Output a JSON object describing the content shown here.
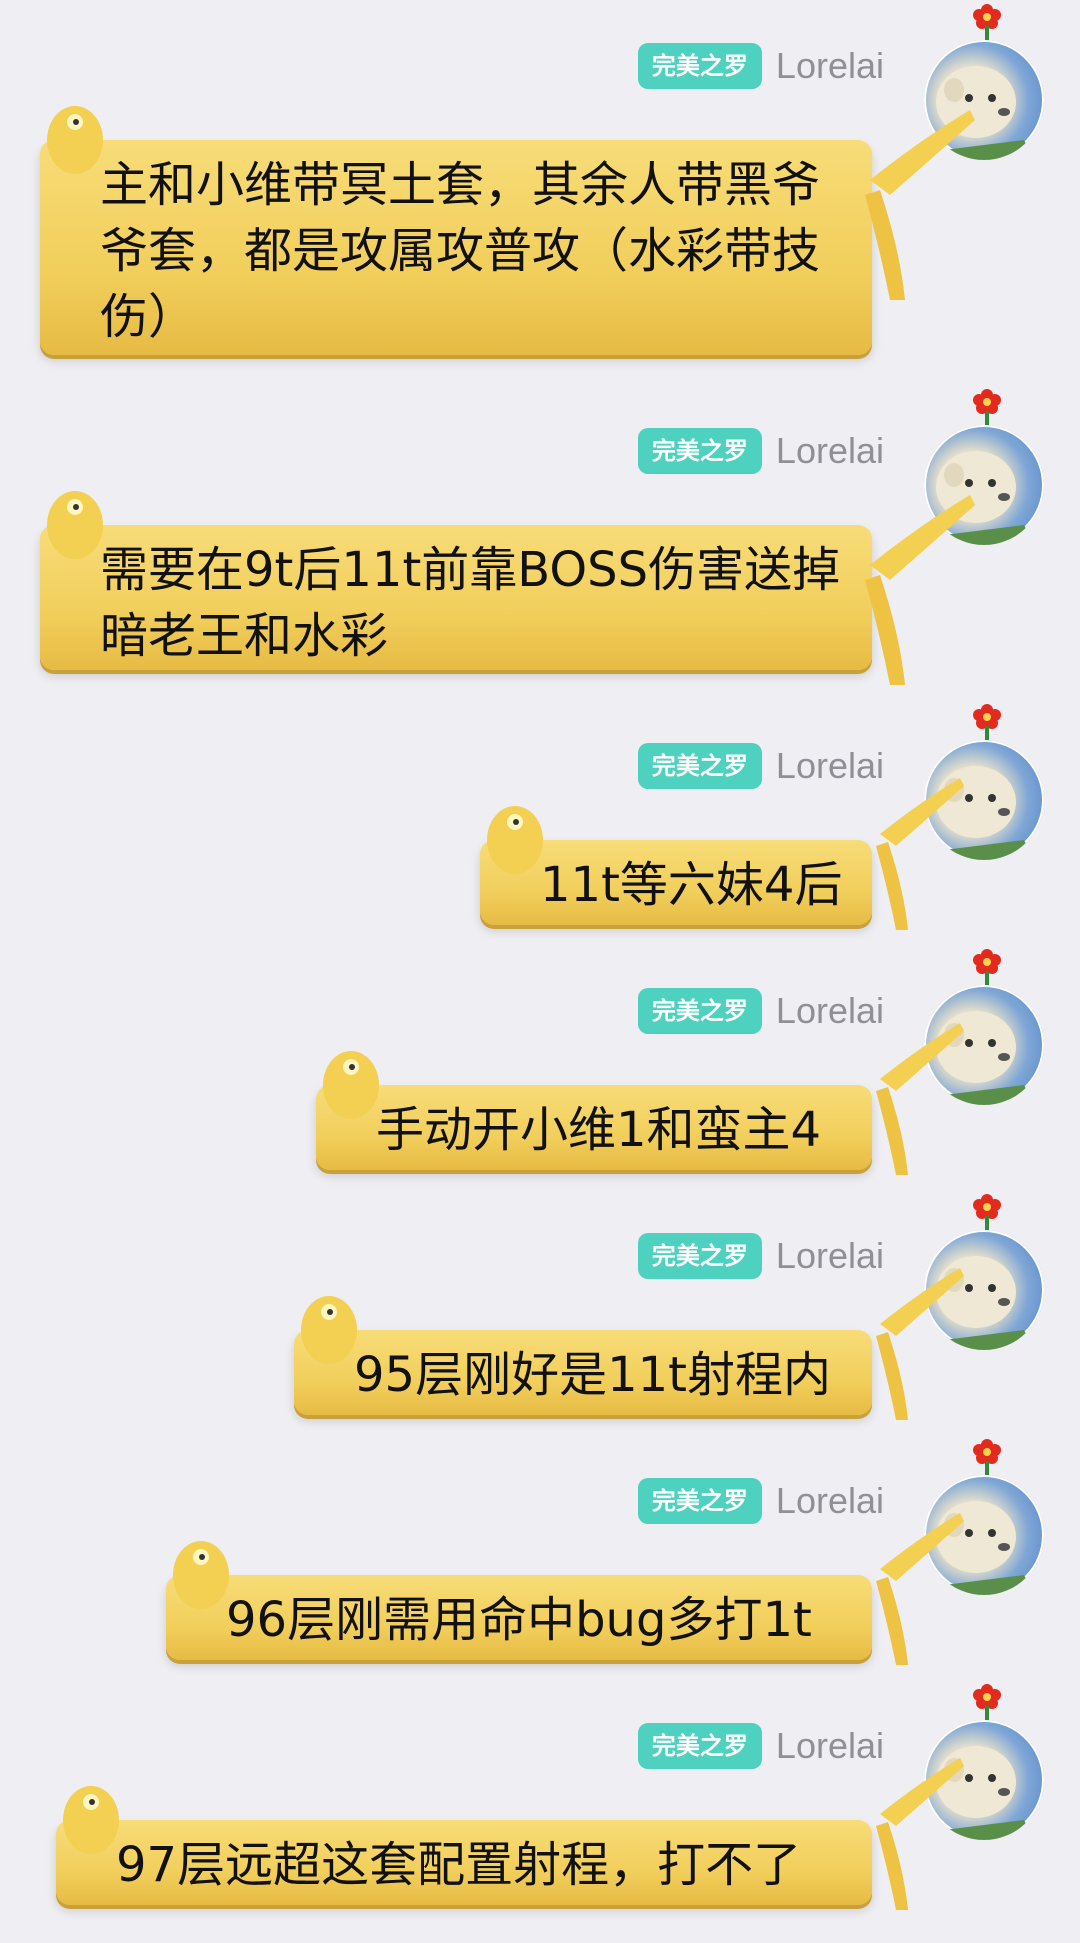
{
  "messages": [
    {
      "badge": "完美之罗",
      "sender": "Lorelai",
      "text": "主和小维带冥土套，其余人带黑爷爷套，都是攻属攻普攻（水彩带技伤）"
    },
    {
      "badge": "完美之罗",
      "sender": "Lorelai",
      "text": "需要在9t后11t前靠BOSS伤害送掉暗老王和水彩"
    },
    {
      "badge": "完美之罗",
      "sender": "Lorelai",
      "text": "11t等六妹4后"
    },
    {
      "badge": "完美之罗",
      "sender": "Lorelai",
      "text": "手动开小维1和蛮主4"
    },
    {
      "badge": "完美之罗",
      "sender": "Lorelai",
      "text": "95层刚好是11t射程内"
    },
    {
      "badge": "完美之罗",
      "sender": "Lorelai",
      "text": "96层刚需用命中bug多打1t"
    },
    {
      "badge": "完美之罗",
      "sender": "Lorelai",
      "text": "97层远超这套配置射程，打不了"
    }
  ],
  "colors": {
    "background": "#efeff3",
    "badge": "#4fd1c0",
    "bubble": "#f2cf5c",
    "sender": "#8f8f95"
  },
  "icons": {
    "avatar": "dog-avatar-icon",
    "flower": "red-flower-icon",
    "bubble_figure": "yellow-figure-icon"
  }
}
